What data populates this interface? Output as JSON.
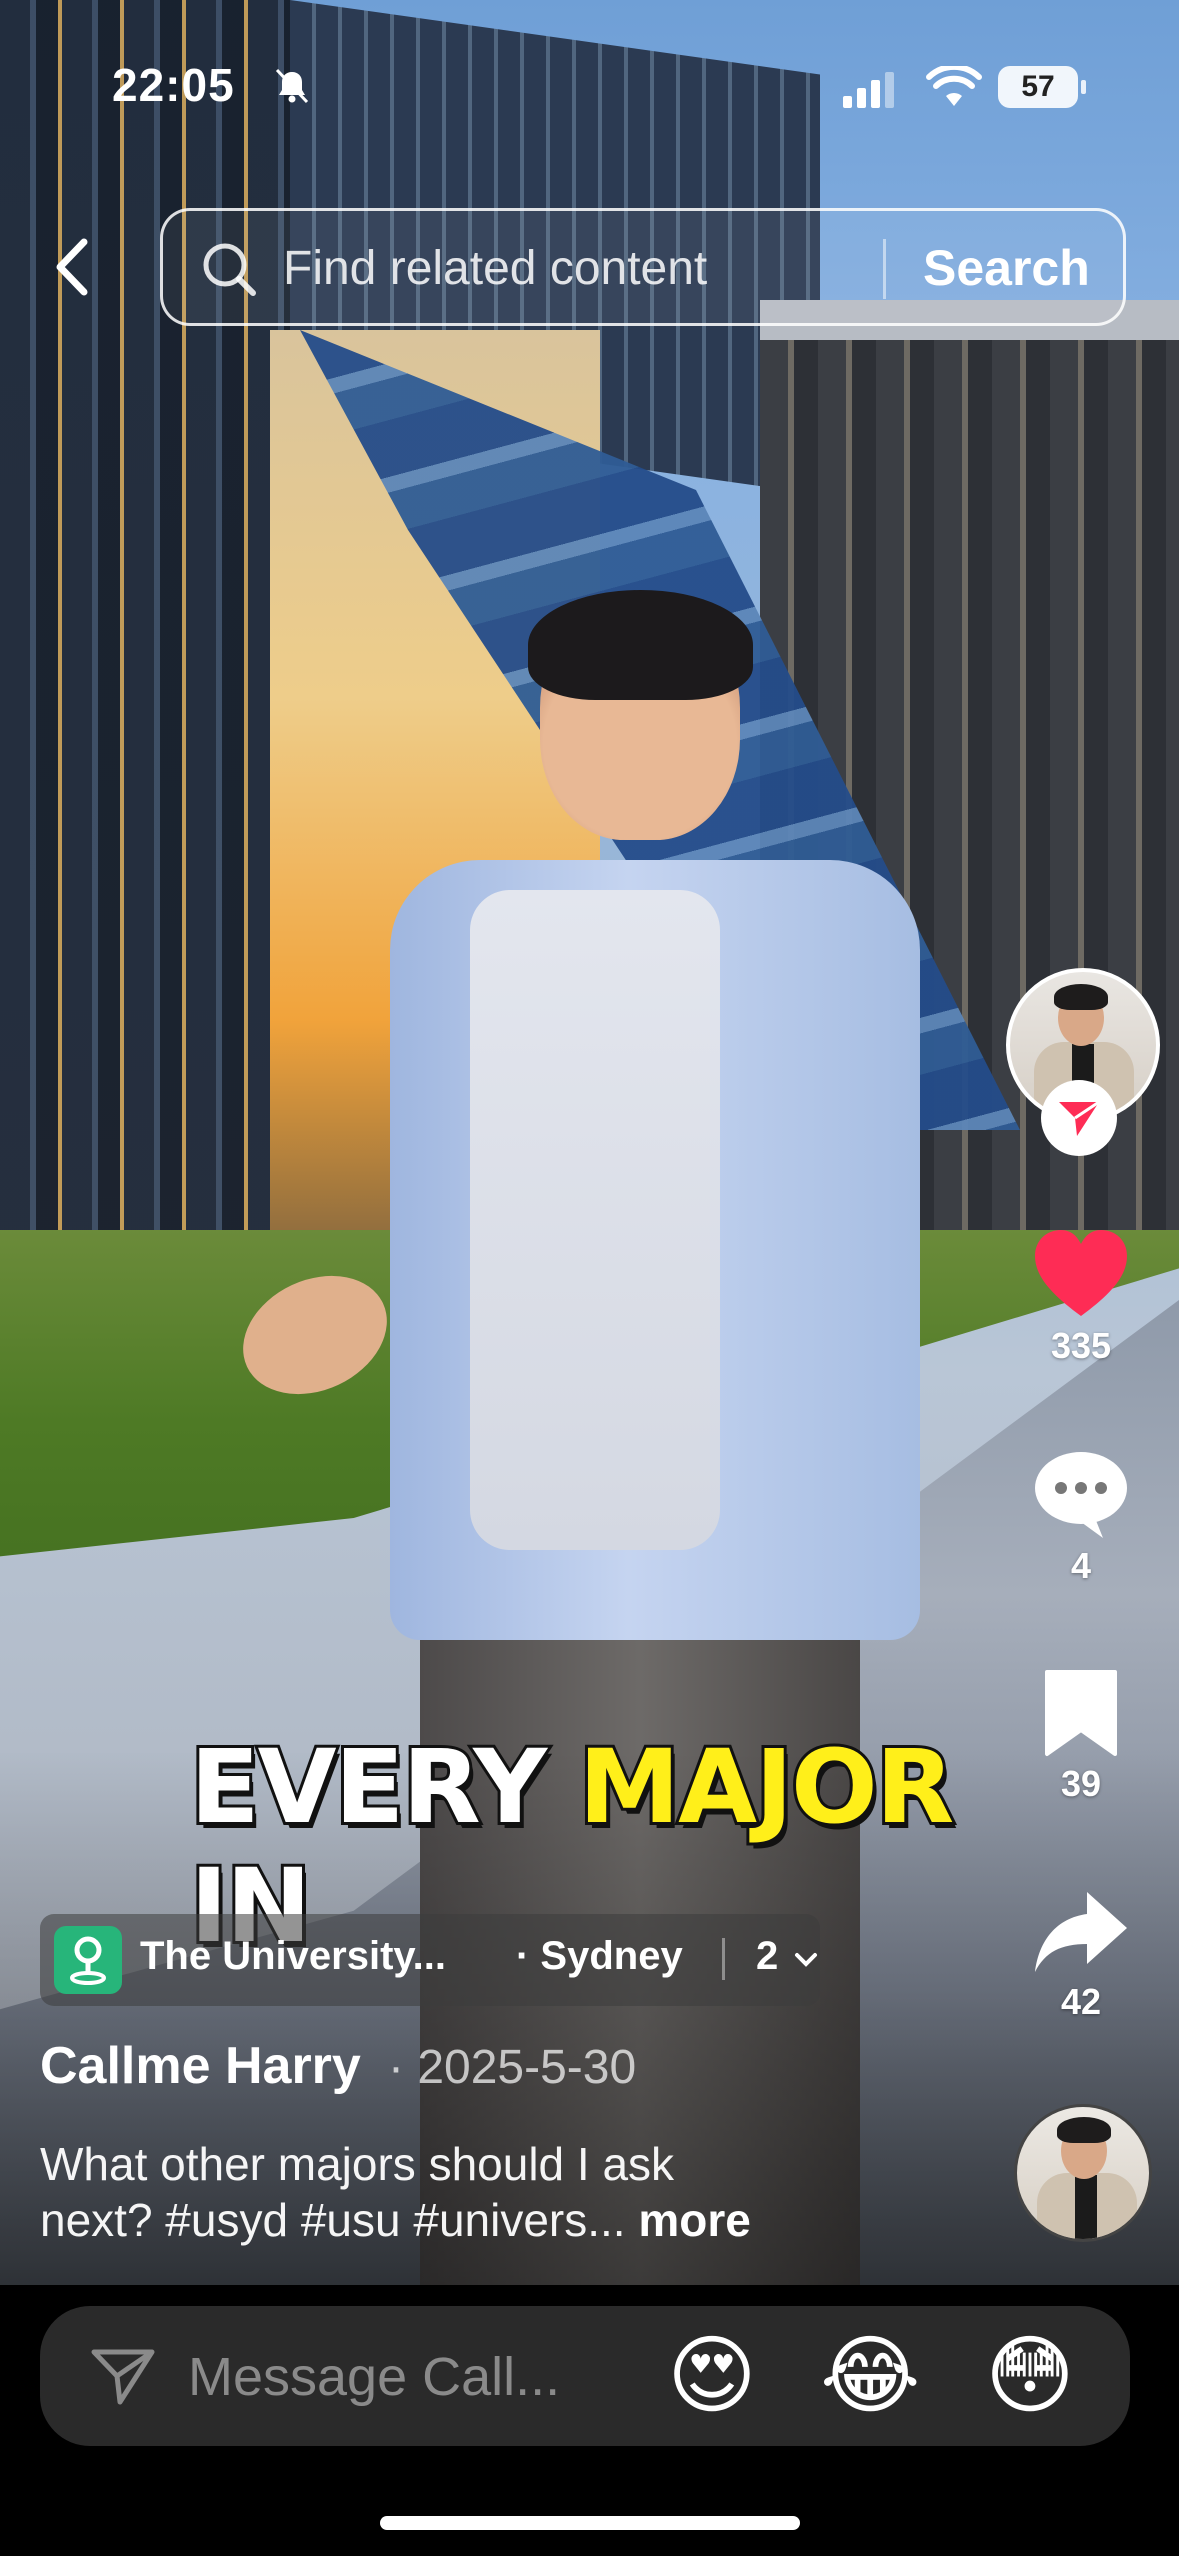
{
  "status_bar": {
    "time": "22:05",
    "battery": "57",
    "icons": [
      "bell-slash-icon",
      "cellular-signal-icon",
      "wifi-icon",
      "battery-icon"
    ]
  },
  "search_bar": {
    "placeholder": "Find related content",
    "button_label": "Search",
    "icons": [
      "back-arrow-icon",
      "search-icon"
    ]
  },
  "video": {
    "caption_words": [
      "EVERY",
      "MAJOR",
      "IN"
    ],
    "caption_highlight_color": "#ffef1a"
  },
  "actions": {
    "likes": "335",
    "comments": "4",
    "bookmarks": "39",
    "shares": "42",
    "like_color": "#fe2c55",
    "icons": [
      "avatar",
      "follow-icon",
      "heart-icon",
      "comment-icon",
      "bookmark-icon",
      "share-icon",
      "music-disc"
    ]
  },
  "location": {
    "name": "The University...",
    "city": "· Sydney",
    "count": "2",
    "icon": "location-pin-icon"
  },
  "post": {
    "author": "Callme Harry",
    "date": "· 2025-5-30",
    "description_line1": "What other majors should I ask",
    "description_line2": "next? #usyd #usu #univers...",
    "more": "more"
  },
  "message_bar": {
    "placeholder": "Message Call...",
    "emojis": [
      "😍",
      "😂",
      "😳"
    ]
  }
}
